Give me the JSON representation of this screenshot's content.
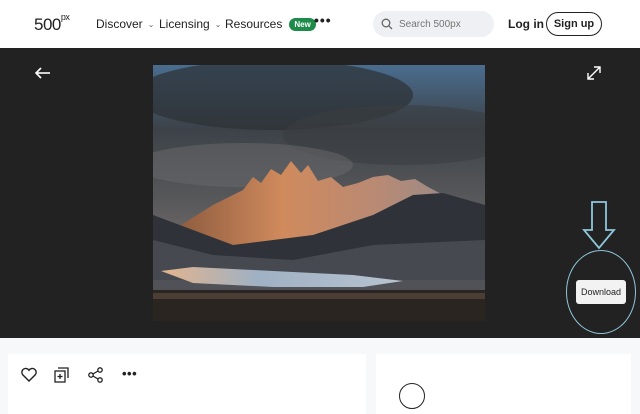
{
  "header": {
    "logo_main": "500",
    "logo_sup": "px",
    "nav": [
      {
        "label": "Discover"
      },
      {
        "label": "Licensing"
      },
      {
        "label": "Resources",
        "badge": "New"
      }
    ],
    "search_placeholder": "Search 500px",
    "login_label": "Log in",
    "signup_label": "Sign up"
  },
  "viewer": {
    "download_label": "Download"
  },
  "icons": {
    "back": "arrow-left-icon",
    "expand": "expand-icon",
    "search": "search-icon",
    "like": "heart-icon",
    "add_to_gallery": "add-gallery-icon",
    "share": "share-icon",
    "more": "more-icon"
  },
  "colors": {
    "viewer_bg": "#222222",
    "badge_bg": "#1d8b4a",
    "annotation": "#8ec6dc"
  }
}
